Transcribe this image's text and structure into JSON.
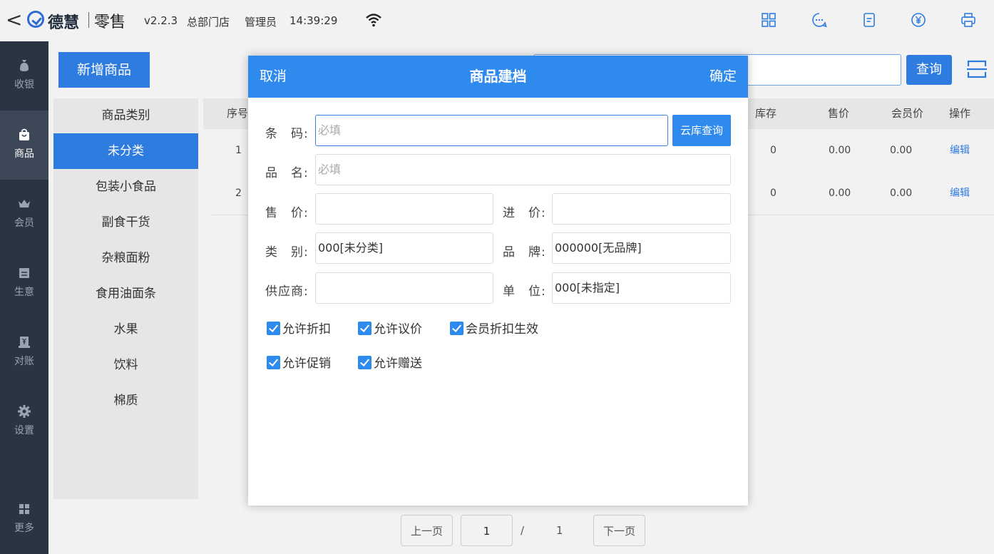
{
  "header": {
    "back_symbol": "<",
    "brand": "德慧",
    "product": "零售",
    "version": "v2.2.3",
    "store": "总部门店",
    "user": "管理员",
    "time": "14:39:29",
    "icons": [
      "grid-icon",
      "chat-icon",
      "document-icon",
      "yen-icon",
      "printer-icon"
    ]
  },
  "sidebar": {
    "items": [
      {
        "label": "收银",
        "icon": "money-bag-icon"
      },
      {
        "label": "商品",
        "icon": "bag-icon"
      },
      {
        "label": "会员",
        "icon": "crown-icon"
      },
      {
        "label": "生意",
        "icon": "report-icon"
      },
      {
        "label": "对账",
        "icon": "ledger-icon"
      },
      {
        "label": "设置",
        "icon": "gear-icon"
      },
      {
        "label": "更多",
        "icon": "apps-icon"
      }
    ]
  },
  "main": {
    "add_button": "新增商品",
    "query_button": "查询",
    "categories": {
      "header": "商品类别",
      "items": [
        "未分类",
        "包装小食品",
        "副食干货",
        "杂粮面粉",
        "食用油面条",
        "水果",
        "饮料",
        "棉质"
      ]
    },
    "table": {
      "headers": {
        "index": "序号",
        "stock": "库存",
        "price": "售价",
        "member_price": "会员价",
        "action": "操作"
      },
      "rows": [
        {
          "index": "1",
          "stock": "0",
          "price": "0.00",
          "member_price": "0.00",
          "action": "编辑"
        },
        {
          "index": "2",
          "stock": "0",
          "price": "0.00",
          "member_price": "0.00",
          "action": "编辑"
        }
      ]
    },
    "pager": {
      "prev": "上一页",
      "current": "1",
      "slash": "/",
      "total": "1",
      "next": "下一页"
    }
  },
  "modal": {
    "cancel": "取消",
    "title": "商品建档",
    "confirm": "确定",
    "cloud_search": "云库查询",
    "fields": {
      "barcode": {
        "label": "条　码:",
        "placeholder": "必填",
        "value": ""
      },
      "name": {
        "label": "品　名:",
        "placeholder": "必填",
        "value": ""
      },
      "price": {
        "label": "售　价:",
        "value": ""
      },
      "cost": {
        "label": "进　价:",
        "value": ""
      },
      "category": {
        "label": "类　别:",
        "value": "000[未分类]"
      },
      "brand": {
        "label": "品　牌:",
        "value": "000000[无品牌]"
      },
      "supplier": {
        "label": "供应商:",
        "value": ""
      },
      "unit": {
        "label": "单　位:",
        "value": "000[未指定]"
      }
    },
    "checkboxes": [
      {
        "label": "允许折扣",
        "checked": true
      },
      {
        "label": "允许议价",
        "checked": true
      },
      {
        "label": "会员折扣生效",
        "checked": true
      },
      {
        "label": "允许促销",
        "checked": true
      },
      {
        "label": "允许赠送",
        "checked": true
      }
    ]
  },
  "colors": {
    "accent": "#2f8aee",
    "sidebar": "#2b3442"
  }
}
